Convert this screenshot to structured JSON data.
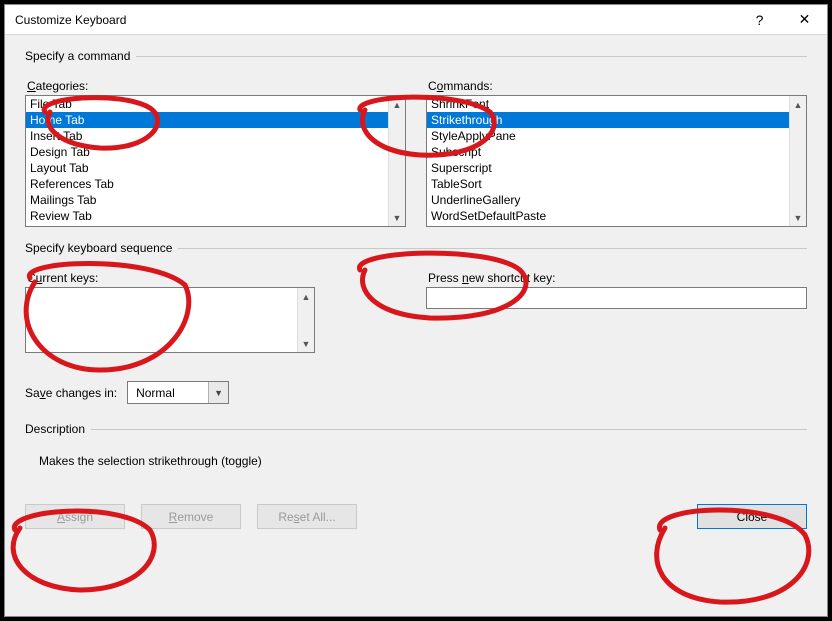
{
  "title": "Customize Keyboard",
  "group_command": "Specify a command",
  "categories_label": "Categories:",
  "commands_label": "Commands:",
  "categories": [
    "File Tab",
    "Home Tab",
    "Insert Tab",
    "Design Tab",
    "Layout Tab",
    "References Tab",
    "Mailings Tab",
    "Review Tab"
  ],
  "categories_selected_index": 1,
  "commands": [
    "ShrinkFont",
    "Strikethrough",
    "StyleApplyPane",
    "Subscript",
    "Superscript",
    "TableSort",
    "UnderlineGallery",
    "WordSetDefaultPaste"
  ],
  "commands_selected_index": 1,
  "group_sequence": "Specify keyboard sequence",
  "current_keys_label": "Current keys:",
  "press_new_label_pre": "Press ",
  "press_new_label_u": "n",
  "press_new_label_post": "ew shortcut key:",
  "shortcut_value": "",
  "save_label_pre": "Sa",
  "save_label_u": "v",
  "save_label_post": "e changes in:",
  "save_value": "Normal",
  "group_desc": "Description",
  "desc_text": "Makes the selection strikethrough (toggle)",
  "btn_assign": "Assign",
  "btn_remove": "Remove",
  "btn_reset": "Reset All...",
  "btn_close": "Close"
}
